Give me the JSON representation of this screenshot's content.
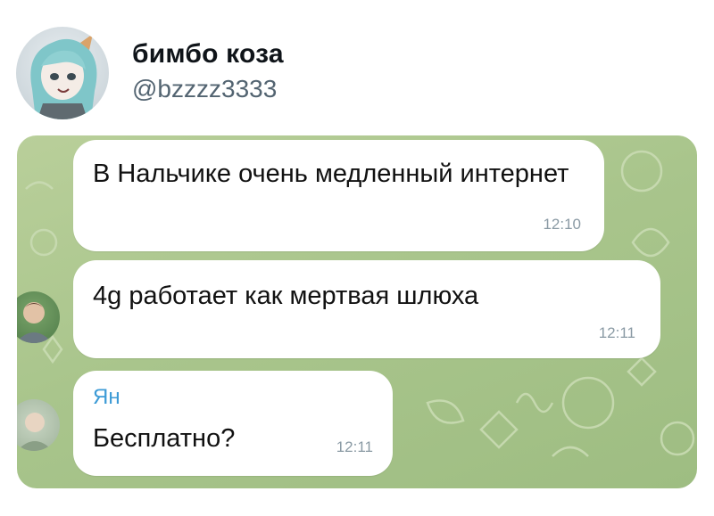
{
  "tweet": {
    "display_name": "бимбо коза",
    "handle": "@bzzzz3333"
  },
  "chat": {
    "messages": [
      {
        "text": "В Нальчике очень медленный интернет",
        "time": "12:10"
      },
      {
        "text": "4g работает как мертвая шлюха",
        "time": "12:11"
      },
      {
        "sender": "Ян",
        "text": "Бесплатно?",
        "time": "12:11"
      }
    ],
    "colors": {
      "wallpaper": "#a9c58c",
      "bubble": "#ffffff",
      "sender_name": "#3d9bd6",
      "timestamp": "#8a9aa4"
    }
  }
}
